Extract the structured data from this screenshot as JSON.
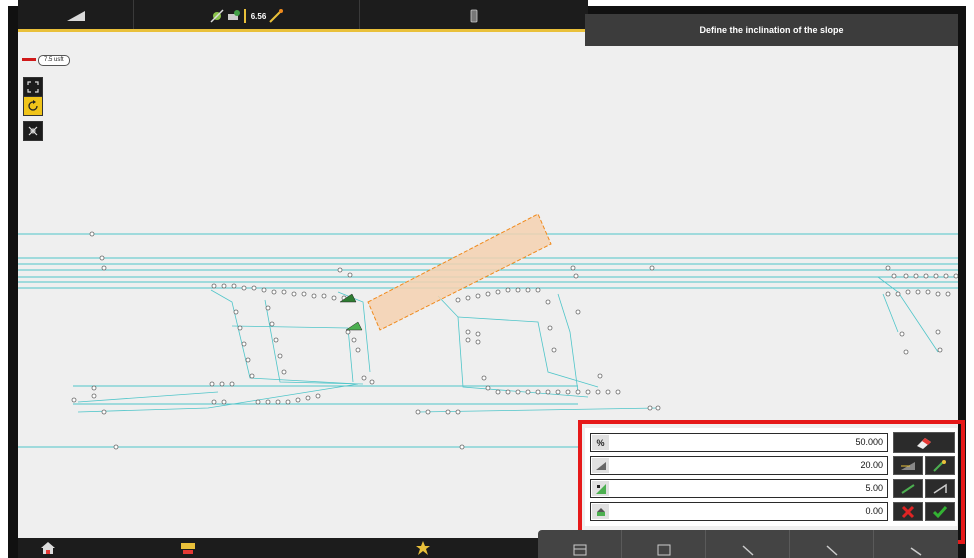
{
  "header": {
    "title": "Define the inclination of the slope",
    "status_value": "6.56",
    "sections": [
      {
        "name": "slope-mode-icon"
      },
      {
        "name": "gnss-status-icon"
      },
      {
        "name": "controller-icon"
      }
    ]
  },
  "map": {
    "scale_label": "7.5 usft",
    "tools": [
      "zoom-extents-icon",
      "rotate-icon",
      "center-icon"
    ]
  },
  "slope_panel": {
    "rows": [
      {
        "icon": "percent-icon",
        "icon_text": "%",
        "value": "50.000"
      },
      {
        "icon": "ratio-icon",
        "icon_text": "",
        "value": "20.00"
      },
      {
        "icon": "height-icon",
        "icon_text": "",
        "value": "5.00"
      },
      {
        "icon": "offset-icon",
        "icon_text": "",
        "value": "0.00"
      }
    ],
    "colors": {
      "accept": "#33b233",
      "cancel": "#e02424",
      "highlight": "#e61919",
      "accent": "#e9c03a",
      "slope_fill": "#f5d1b0",
      "slope_border": "#f08a1c"
    }
  },
  "bottom": {
    "items": [
      "home-icon",
      "machine-icon",
      "favorite-icon"
    ],
    "tabs": [
      "layers-icon",
      "map-view-icon",
      "search-icon",
      "zoom-icon",
      "settings-icon"
    ]
  }
}
